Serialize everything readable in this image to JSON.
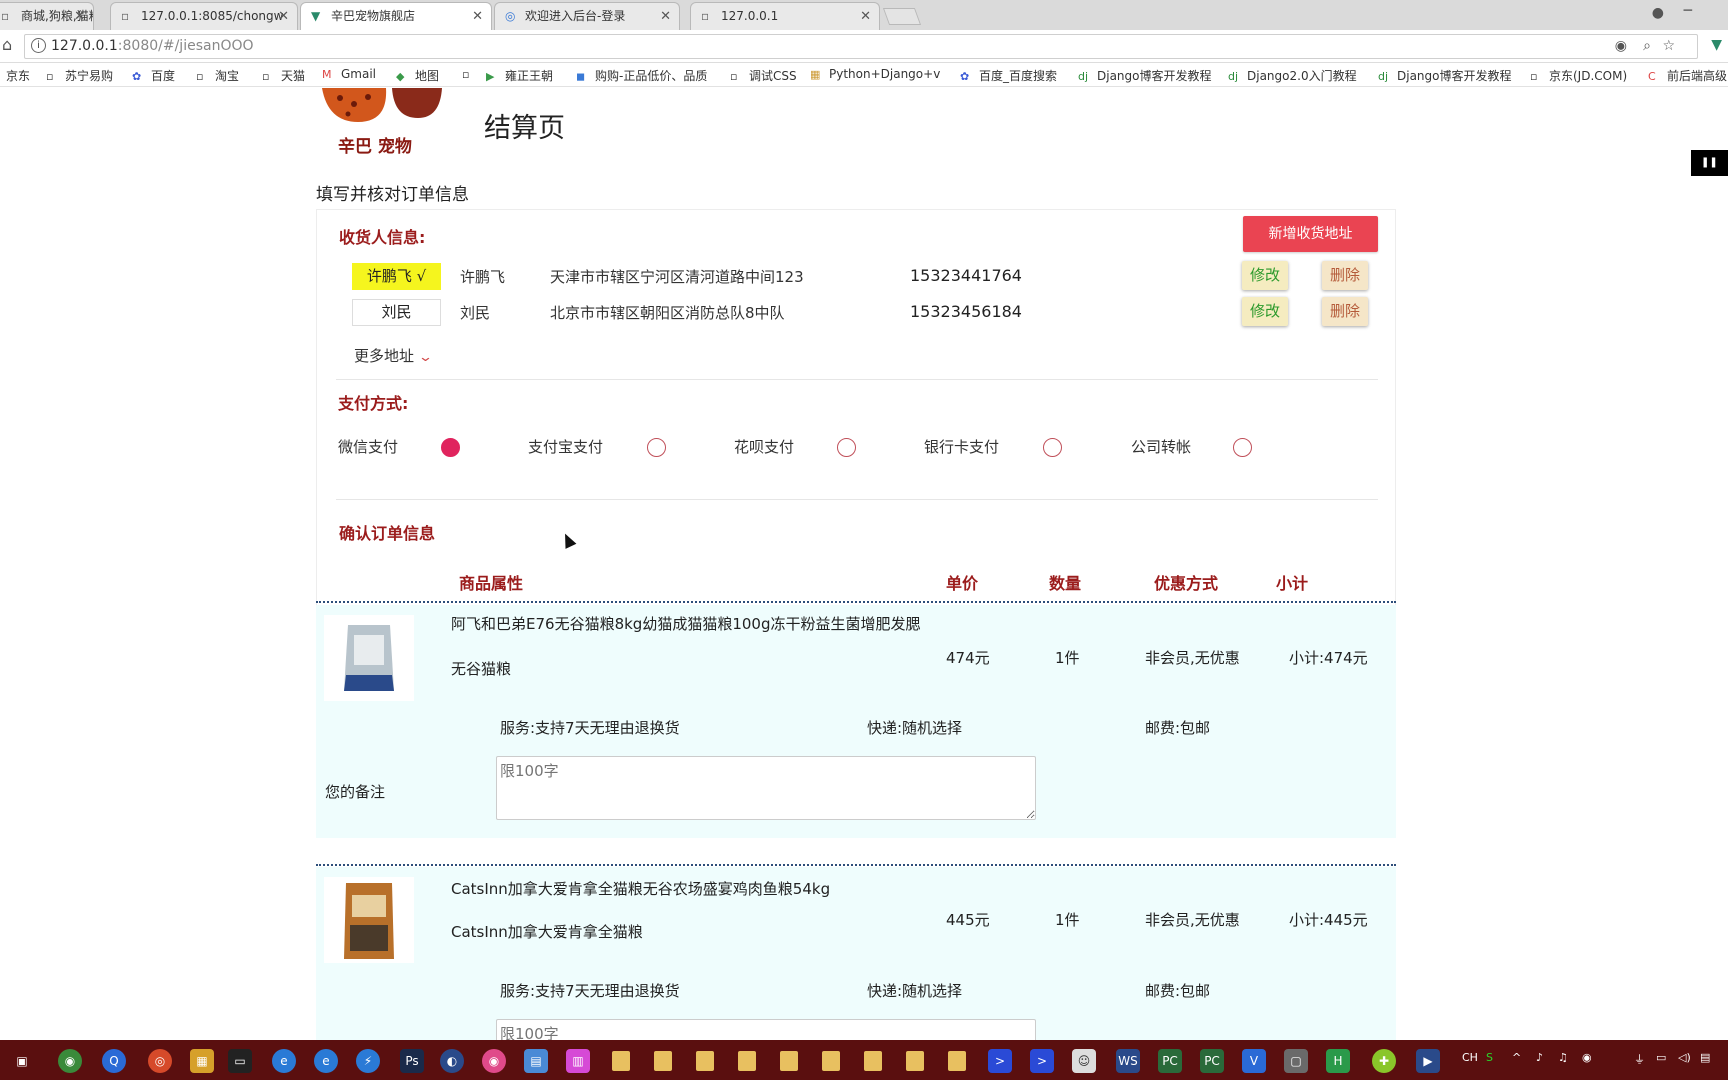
{
  "browser": {
    "tabs": [
      {
        "label": "商城,狗粮,猫粮",
        "icon": "page-icon"
      },
      {
        "label": "127.0.0.1:8085/chongw",
        "icon": "page-icon"
      },
      {
        "label": "辛巴宠物旗舰店",
        "icon": "vue-icon",
        "active": true
      },
      {
        "label": "欢迎进入后台-登录",
        "icon": "globe-icon"
      },
      {
        "label": "127.0.0.1",
        "icon": "page-icon"
      }
    ],
    "url_host": "127.0.0.1",
    "url_rest": ":8080/#/jiesanOOO",
    "bookmarks": [
      "京东",
      "苏宁易购",
      "百度",
      "淘宝",
      "天猫",
      "Gmail",
      "地图",
      "雍正王朝",
      "购购-正品低价、品质",
      "调试CSS",
      "Python+Django+v",
      "百度_百度搜索",
      "Django博客开发教程",
      "Django2.0入门教程",
      "Django博客开发教程",
      "京东(JD.COM)",
      "前后端高级"
    ]
  },
  "header": {
    "logo_text": "辛巴 宠物",
    "page_title": "结算页",
    "sub_title": "填写并核对订单信息"
  },
  "consignee": {
    "heading": "收货人信息:",
    "add_button": "新增收货地址",
    "edit_label": "修改",
    "delete_label": "删除",
    "more_label": "更多地址",
    "addresses": [
      {
        "tag": "许鹏飞 √",
        "name": "许鹏飞",
        "address": "天津市市辖区宁河区清河道路中间123",
        "phone": "15323441764",
        "selected": true
      },
      {
        "tag": "刘民",
        "name": "刘民",
        "address": "北京市市辖区朝阳区消防总队8中队",
        "phone": "15323456184",
        "selected": false
      }
    ]
  },
  "payment": {
    "heading": "支付方式:",
    "methods": [
      {
        "label": "微信支付",
        "checked": true
      },
      {
        "label": "支付宝支付",
        "checked": false
      },
      {
        "label": "花呗支付",
        "checked": false
      },
      {
        "label": "银行卡支付",
        "checked": false
      },
      {
        "label": "公司转帐",
        "checked": false
      }
    ]
  },
  "order": {
    "heading": "确认订单信息",
    "columns": [
      "商品属性",
      "单价",
      "数量",
      "优惠方式",
      "小计"
    ],
    "remark_label": "您的备注",
    "remark_placeholder": "限100字",
    "items": [
      {
        "title": "阿飞和巴弟E76无谷猫粮8kg幼猫成猫猫粮100g冻干粉益生菌增肥发腮",
        "subtitle": "无谷猫粮",
        "price": "474元",
        "qty": "1件",
        "discount": "非会员,无优惠",
        "subtotal": "小计:474元",
        "service": "服务:支持7天无理由退换货",
        "delivery": "快递:随机选择",
        "postage": "邮费:包邮"
      },
      {
        "title": "CatsInn加拿大爱肯拿全猫粮无谷农场盛宴鸡肉鱼粮54kg",
        "subtitle": "CatsInn加拿大爱肯拿全猫粮",
        "price": "445元",
        "qty": "1件",
        "discount": "非会员,无优惠",
        "subtotal": "小计:445元",
        "service": "服务:支持7天无理由退换货",
        "delivery": "快递:随机选择",
        "postage": "邮费:包邮"
      }
    ]
  },
  "taskbar": {
    "ime": "CH"
  },
  "colors": {
    "accent_red": "#9b1c1c",
    "button_red": "#ea4452",
    "radio_checked": "#e0245e",
    "item_bg": "#effdfd",
    "taskbar": "#5a0f0f"
  }
}
